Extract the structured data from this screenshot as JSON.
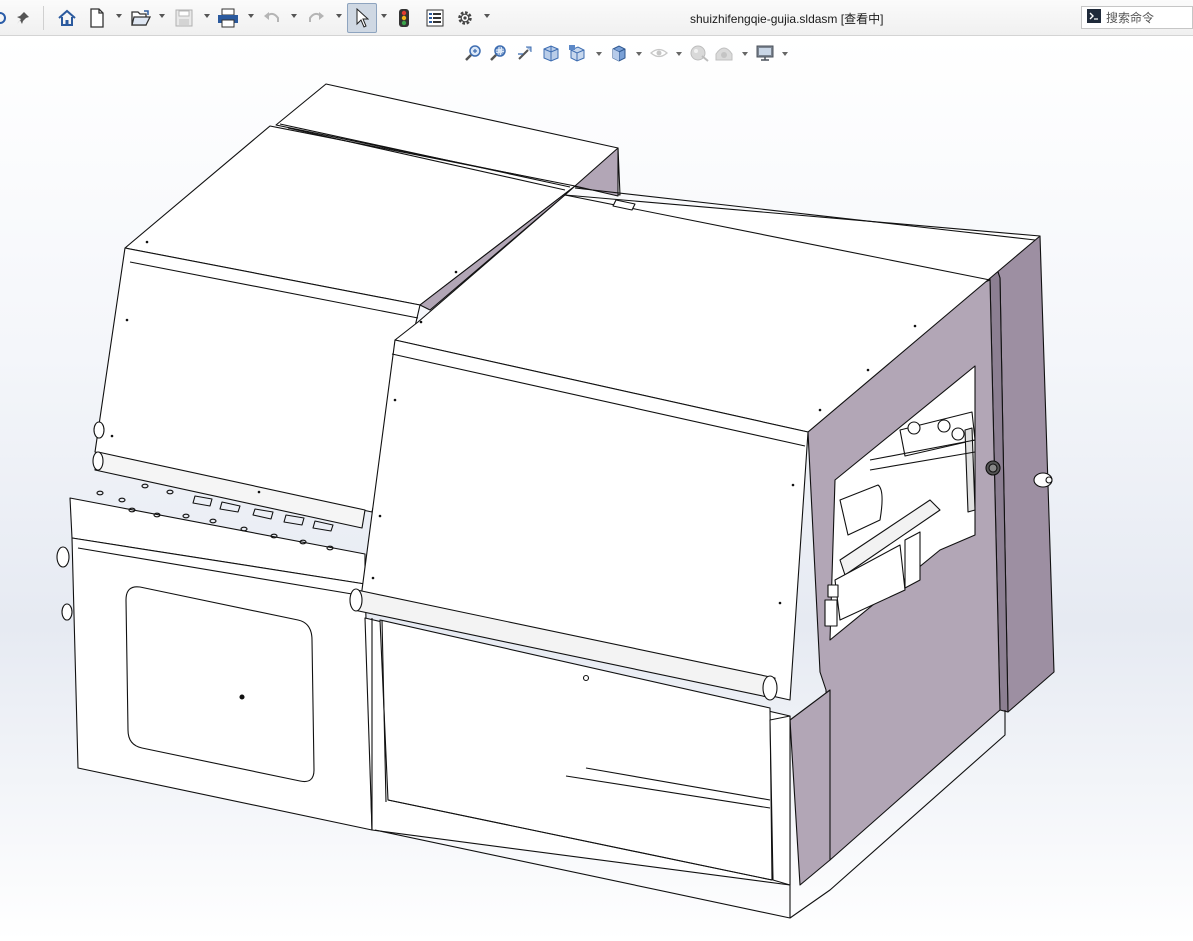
{
  "window": {
    "title": "shuizhifengqie-gujia.sldasm [查看中]"
  },
  "toolbar": {
    "items": [
      {
        "name": "home-icon"
      },
      {
        "name": "new-document-icon"
      },
      {
        "name": "open-icon"
      },
      {
        "name": "save-icon"
      },
      {
        "name": "print-icon"
      },
      {
        "name": "undo-icon"
      },
      {
        "name": "redo-icon"
      },
      {
        "name": "select-cursor-icon"
      },
      {
        "name": "rebuild-traffic-light-icon"
      },
      {
        "name": "file-properties-icon"
      },
      {
        "name": "options-gear-icon"
      }
    ]
  },
  "search": {
    "placeholder": "搜索命令"
  },
  "view_toolbar": {
    "items": [
      {
        "name": "zoom-to-fit-icon"
      },
      {
        "name": "zoom-to-area-icon"
      },
      {
        "name": "previous-view-icon"
      },
      {
        "name": "section-view-icon"
      },
      {
        "name": "view-orientation-icon"
      },
      {
        "name": "display-style-icon"
      },
      {
        "name": "hide-show-items-icon"
      },
      {
        "name": "edit-appearance-icon"
      },
      {
        "name": "apply-scene-icon"
      },
      {
        "name": "view-settings-icon"
      }
    ]
  },
  "colors": {
    "accent_selected": "#cfd8e3",
    "side_panel_mauve": "#b2a6b6",
    "side_panel_dark": "#9d8fa2",
    "line": "#111111"
  }
}
